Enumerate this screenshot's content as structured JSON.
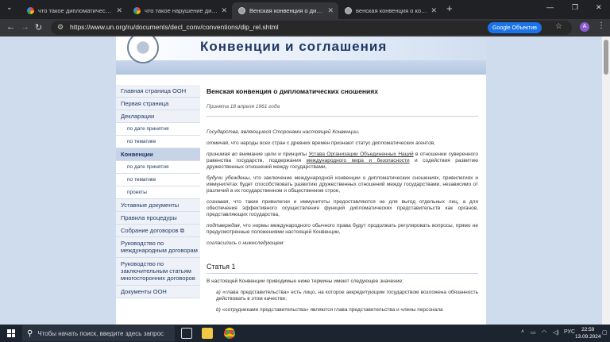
{
  "browser": {
    "tabs": [
      {
        "title": "что такое дипломатический и",
        "favicon": "google",
        "active": false
      },
      {
        "title": "что такое нарушение диплом.",
        "favicon": "google",
        "active": false
      },
      {
        "title": "Венская конвенция о диплом.",
        "favicon": "un",
        "active": true
      },
      {
        "title": "венская конвенция о консул.",
        "favicon": "un",
        "active": false
      }
    ],
    "url": "https://www.un.org/ru/documents/decl_conv/conventions/dip_rel.shtml",
    "lens_label": "Google Объектив",
    "profile_initial": "A"
  },
  "site": {
    "title": "Конвенции и соглашения"
  },
  "sidebar": {
    "items": [
      {
        "label": "Главная страница ООН",
        "sub": false,
        "active": false
      },
      {
        "label": "Первая страница",
        "sub": false,
        "active": false
      },
      {
        "label": "Декларации",
        "sub": false,
        "active": false
      },
      {
        "label": "по дате принятия",
        "sub": true,
        "active": false
      },
      {
        "label": "по тематике",
        "sub": true,
        "active": false
      },
      {
        "label": "Конвенции",
        "sub": false,
        "active": true
      },
      {
        "label": "по дате принятия",
        "sub": true,
        "active": false
      },
      {
        "label": "по тематике",
        "sub": true,
        "active": false
      },
      {
        "label": "проекты",
        "sub": true,
        "active": false
      },
      {
        "label": "Уставные документы",
        "sub": false,
        "active": false
      },
      {
        "label": "Правила процедуры",
        "sub": false,
        "active": false
      },
      {
        "label": "Собрание договоров ⧉",
        "sub": false,
        "active": false
      },
      {
        "label": "Руководство по международным договорам",
        "sub": false,
        "active": false
      },
      {
        "label": "Руководство по заключительным статьям многосторонних договоров",
        "sub": false,
        "active": false
      },
      {
        "label": "Документы ООН",
        "sub": false,
        "active": false
      }
    ]
  },
  "document": {
    "title": "Венская конвенция о дипломатических сношениях",
    "date": "Принята 18 апреля 1961 года",
    "intro": "Государства, являющиеся Сторонами настоящей Конвенции,",
    "p1_lead": "отмечая",
    "p1_text": ", что народы всех стран с древних времен признают статус дипломатических агентов,",
    "p2_lead": "принимая во",
    "p2_text1": " внимание цели и принципы ",
    "p2_link1": "Устава Организации Объединенных Наций",
    "p2_text2": " в отношении суверенного равенства государств, поддержания ",
    "p2_link2": "международного мира и безопасности",
    "p2_text3": " и содействия развитию дружественных отношений между государствами,",
    "p3_lead": "будучи убеждены",
    "p3_text": ", что заключение международной конвенции о дипломатических сношениях, привилегиях и иммунитетах будет способствовать развитию дружественных отношений между государствами, независимо от различий в их государственном и общественном строе,",
    "p4_lead": "сознавая",
    "p4_text": ", что такие привилегии и иммунитеты предоставляются не для выгод отдельных лиц, а для обеспечения эффективного осуществления функций дипломатических представительств как органов, представляющих государства,",
    "p5_lead": "подтверждая",
    "p5_text": ", что нормы международного обычного права будут продолжать регулировать вопросы, прямо не предусмотренные положениями настоящей Конвенции,",
    "p6": "согласились о нижеследующем:",
    "article_title": "Статья 1",
    "article_intro": "В настоящей Конвенции приводимые ниже термины имеют следующее значение:",
    "item_a_lead": "a)",
    "item_a_text": " «глава представительства» есть лицо, на которое аккредитующим государством возложена обязанность действовать в этом качестве;",
    "item_b_lead": "b)",
    "item_b_text": " «сотрудниками представительства» являются глава представительства и члены персонала"
  },
  "taskbar": {
    "search_placeholder": "Чтобы начать поиск, введите здесь запрос",
    "language": "РУС",
    "time": "22:59",
    "date": "13.09.2024"
  }
}
